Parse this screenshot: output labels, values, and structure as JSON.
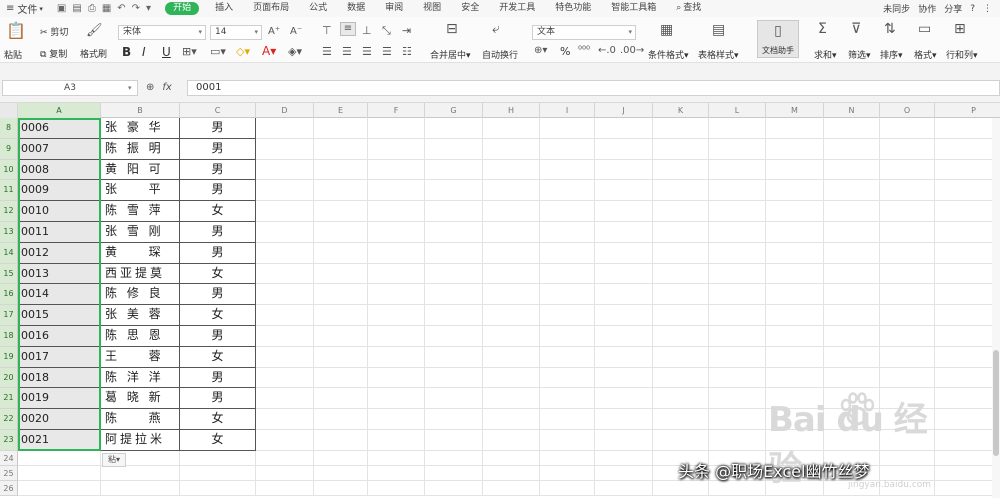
{
  "menubar": {
    "file": "文件",
    "tabs": [
      "开始",
      "插入",
      "页面布局",
      "公式",
      "数据",
      "审阅",
      "视图",
      "安全",
      "开发工具",
      "特色功能",
      "智能工具箱",
      "查找"
    ],
    "active_tab": "开始",
    "right": [
      "未同步",
      "协作",
      "分享"
    ]
  },
  "ribbon": {
    "paste": "粘贴",
    "cut": "剪切",
    "copy": "复制",
    "format_painter": "格式刷",
    "font_name": "宋体",
    "font_size": "14",
    "bold": "B",
    "italic": "I",
    "underline": "U",
    "merge_center": "合并居中",
    "auto_wrap": "自动换行",
    "number_format": "文本",
    "percent": "%",
    "cond_format": "条件格式",
    "table_style": "表格样式",
    "doc_helper": "文档助手",
    "sum": "求和",
    "filter": "筛选",
    "sort": "排序",
    "format": "格式",
    "row_col": "行和列"
  },
  "formula": {
    "name_box": "A3",
    "value": "0001"
  },
  "columns": [
    "A",
    "B",
    "C",
    "D",
    "E",
    "F",
    "G",
    "H",
    "I",
    "J",
    "K",
    "L",
    "M",
    "N",
    "O",
    "P"
  ],
  "rows": [
    {
      "num": "8",
      "id": "0006",
      "name": "张 豪 华",
      "gender": "男"
    },
    {
      "num": "9",
      "id": "0007",
      "name": "陈 振 明",
      "gender": "男"
    },
    {
      "num": "10",
      "id": "0008",
      "name": "黄 阳 可",
      "gender": "男"
    },
    {
      "num": "11",
      "id": "0009",
      "name": "张 　 平",
      "gender": "男"
    },
    {
      "num": "12",
      "id": "0010",
      "name": "陈 雪 萍",
      "gender": "女"
    },
    {
      "num": "13",
      "id": "0011",
      "name": "张 雪 刚",
      "gender": "男"
    },
    {
      "num": "14",
      "id": "0012",
      "name": "黄 　 琛",
      "gender": "男"
    },
    {
      "num": "15",
      "id": "0013",
      "name": "西亚提莫",
      "gender": "女"
    },
    {
      "num": "16",
      "id": "0014",
      "name": "陈 修 良",
      "gender": "男"
    },
    {
      "num": "17",
      "id": "0015",
      "name": "张 美 蓉",
      "gender": "女"
    },
    {
      "num": "18",
      "id": "0016",
      "name": "陈 思 恩",
      "gender": "男"
    },
    {
      "num": "19",
      "id": "0017",
      "name": "王 　 蓉",
      "gender": "女"
    },
    {
      "num": "20",
      "id": "0018",
      "name": "陈 洋 洋",
      "gender": "男"
    },
    {
      "num": "21",
      "id": "0019",
      "name": "葛 晓 新",
      "gender": "男"
    },
    {
      "num": "22",
      "id": "0020",
      "name": "陈 　 燕",
      "gender": "女"
    },
    {
      "num": "23",
      "id": "0021",
      "name": "阿提拉米",
      "gender": "女"
    }
  ],
  "extra_rows": [
    "24",
    "25",
    "26"
  ],
  "paste_options": "粘",
  "watermark": {
    "baidu": "Bai du 经验",
    "author": "头条 @职场Excel幽竹丝梦",
    "small": "jingyan.baidu.com"
  },
  "colors": {
    "accent": "#2fb45a",
    "selected_fill": "#e8e8e8"
  }
}
